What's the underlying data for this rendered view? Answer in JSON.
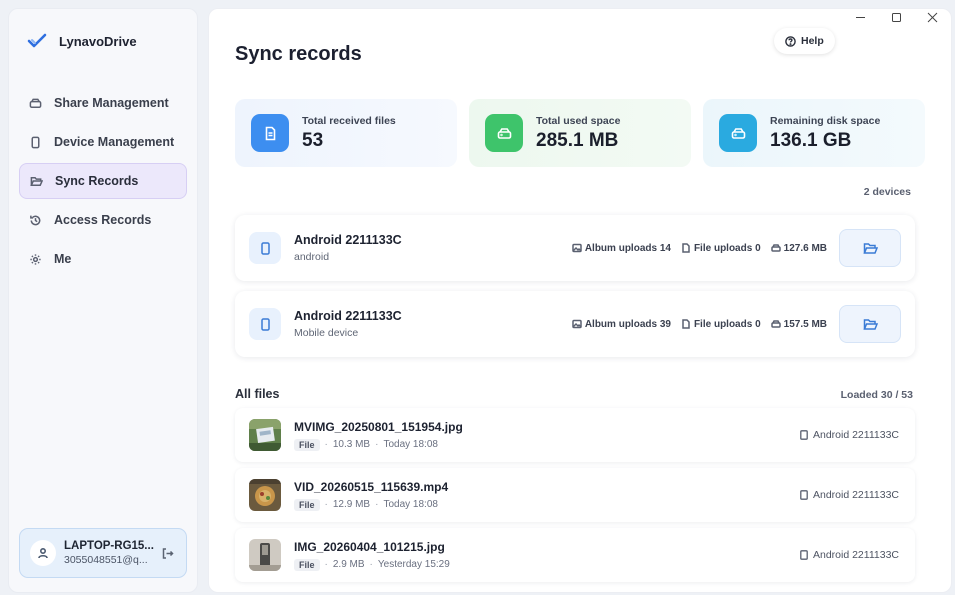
{
  "window": {
    "minimize_icon": "minimize-icon",
    "maximize_icon": "maximize-icon",
    "close_icon": "close-icon"
  },
  "app": {
    "name": "LynavoDrive",
    "logo_icon": "check-logo-icon"
  },
  "sidebar": {
    "items": [
      {
        "label": "Share Management",
        "icon": "drive-icon",
        "active": false
      },
      {
        "label": "Device Management",
        "icon": "phone-icon",
        "active": false
      },
      {
        "label": "Sync Records",
        "icon": "folder-open-icon",
        "active": true
      },
      {
        "label": "Access Records",
        "icon": "history-icon",
        "active": false
      },
      {
        "label": "Me",
        "icon": "gear-icon",
        "active": false
      }
    ],
    "user": {
      "name": "LAPTOP-RG15...",
      "email": "3055048551@q...",
      "avatar_icon": "user-icon",
      "logout_icon": "logout-icon"
    }
  },
  "header": {
    "title": "Sync records",
    "help_label": "Help"
  },
  "stats": [
    {
      "label": "Total received files",
      "value": "53",
      "color": "#3d8ef0",
      "icon": "file-icon"
    },
    {
      "label": "Total used space",
      "value": "285.1 MB",
      "color": "#3ec46b",
      "icon": "drive-icon"
    },
    {
      "label": "Remaining disk space",
      "value": "136.1 GB",
      "color": "#2aaae0",
      "icon": "drive-icon"
    }
  ],
  "devices": {
    "count_label": "2 devices",
    "items": [
      {
        "name": "Android 2211133C",
        "subtitle": "android",
        "album_uploads": "Album uploads 14",
        "file_uploads": "File uploads 0",
        "size": "127.6 MB"
      },
      {
        "name": "Android 2211133C",
        "subtitle": "Mobile device",
        "album_uploads": "Album uploads 39",
        "file_uploads": "File uploads 0",
        "size": "157.5 MB"
      }
    ]
  },
  "files": {
    "title": "All files",
    "loaded_label": "Loaded 30 / 53",
    "items": [
      {
        "name": "MVIMG_20250801_151954.jpg",
        "tag": "File",
        "size": "10.3 MB",
        "time": "Today 18:08",
        "device": "Android 2211133C"
      },
      {
        "name": "VID_20260515_115639.mp4",
        "tag": "File",
        "size": "12.9 MB",
        "time": "Today 18:08",
        "device": "Android 2211133C"
      },
      {
        "name": "IMG_20260404_101215.jpg",
        "tag": "File",
        "size": "2.9 MB",
        "time": "Yesterday 15:29",
        "device": "Android 2211133C"
      }
    ]
  }
}
